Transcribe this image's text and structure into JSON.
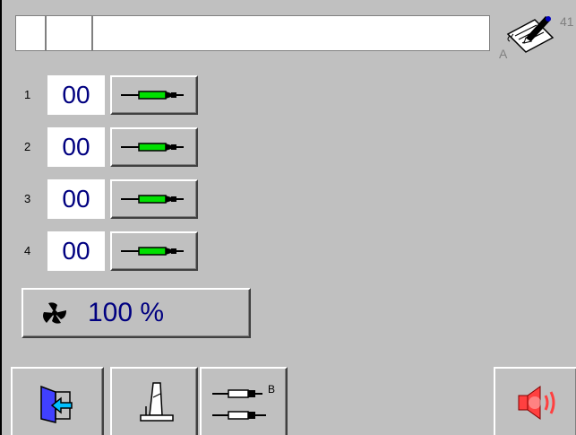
{
  "status_bar": {
    "cell_a": "",
    "cell_b": "",
    "message": ""
  },
  "notepad": {
    "label_a": "A",
    "label_number": "41"
  },
  "tools": [
    {
      "index": "1",
      "value": "00",
      "icon": "syringe-icon"
    },
    {
      "index": "2",
      "value": "00",
      "icon": "syringe-icon"
    },
    {
      "index": "3",
      "value": "00",
      "icon": "syringe-icon"
    },
    {
      "index": "4",
      "value": "00",
      "icon": "syringe-icon"
    }
  ],
  "speed": {
    "icon": "fan-icon",
    "value": "100 %"
  },
  "toolbar": {
    "exit_icon": "exit-door-icon",
    "measure_icon": "measure-icon",
    "tools_icon": "tools-swap-icon",
    "tools_label": "B",
    "alarm_icon": "speaker-alarm-icon"
  },
  "colors": {
    "background": "#c0c0c0",
    "value_text": "#000080",
    "syringe_green": "#00e000",
    "alarm_red": "#ff4040"
  }
}
